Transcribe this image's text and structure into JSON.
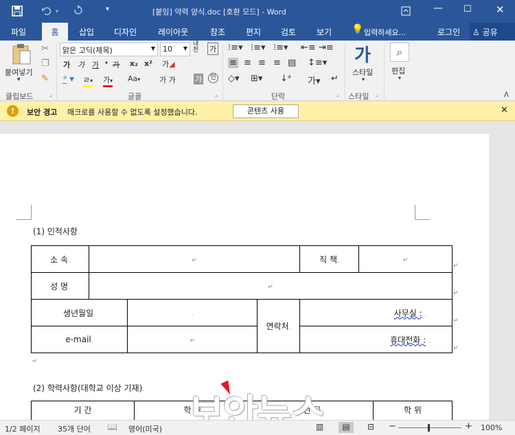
{
  "titlebar": {
    "title": "[붙임] 약력 양식.doc [호환 모드] - Word",
    "qat": {
      "save_icon": "save-icon",
      "undo_icon": "undo-icon",
      "redo_icon": "redo-icon",
      "customize_icon": "customize-icon"
    },
    "window_controls": [
      "ribbon-display-icon",
      "minimize-icon",
      "maximize-icon",
      "close-icon"
    ]
  },
  "tabs": [
    "파일",
    "홈",
    "삽입",
    "디자인",
    "레이아웃",
    "참조",
    "편지",
    "검토",
    "보기"
  ],
  "active_tab": "홈",
  "tell_me": "입력하세요...",
  "login": "로그인",
  "share": "공유",
  "ribbon": {
    "clipboard": {
      "paste": "붙여넣기",
      "group": "클립보드"
    },
    "font": {
      "group": "글꼴",
      "font_name": "맑은 고딕(제목)",
      "font_size": "10",
      "buttons": [
        "가",
        "가",
        "가",
        "가",
        "x₂",
        "x²",
        "가",
        "Aa"
      ]
    },
    "paragraph": {
      "group": "단락"
    },
    "styles": {
      "label": "스타일",
      "group": "스타일"
    },
    "editing": {
      "label": "편집"
    }
  },
  "security": {
    "label": "보안 경고",
    "message": "매크로를 사용할 수 없도록 설정했습니다.",
    "button": "콘텐츠 사용"
  },
  "document": {
    "section1": "(1) 인적사항",
    "table1": {
      "affiliation": "소 속",
      "position": "직 책",
      "name": "성 명",
      "birth": "생년월일",
      "contact": "연락처",
      "office": "사무실 :",
      "email": "e-mail",
      "mobile": "휴대전화 :"
    },
    "section2": "(2) 학력사항(대학교 이상 기재)",
    "table2_headers": [
      "기 간",
      "학 교",
      "전 공",
      "학 위"
    ],
    "watermark": "보안뉴스"
  },
  "status": {
    "page": "1/2 페이지",
    "words": "35개 단어",
    "language": "영어(미국)",
    "zoom": "100%"
  }
}
